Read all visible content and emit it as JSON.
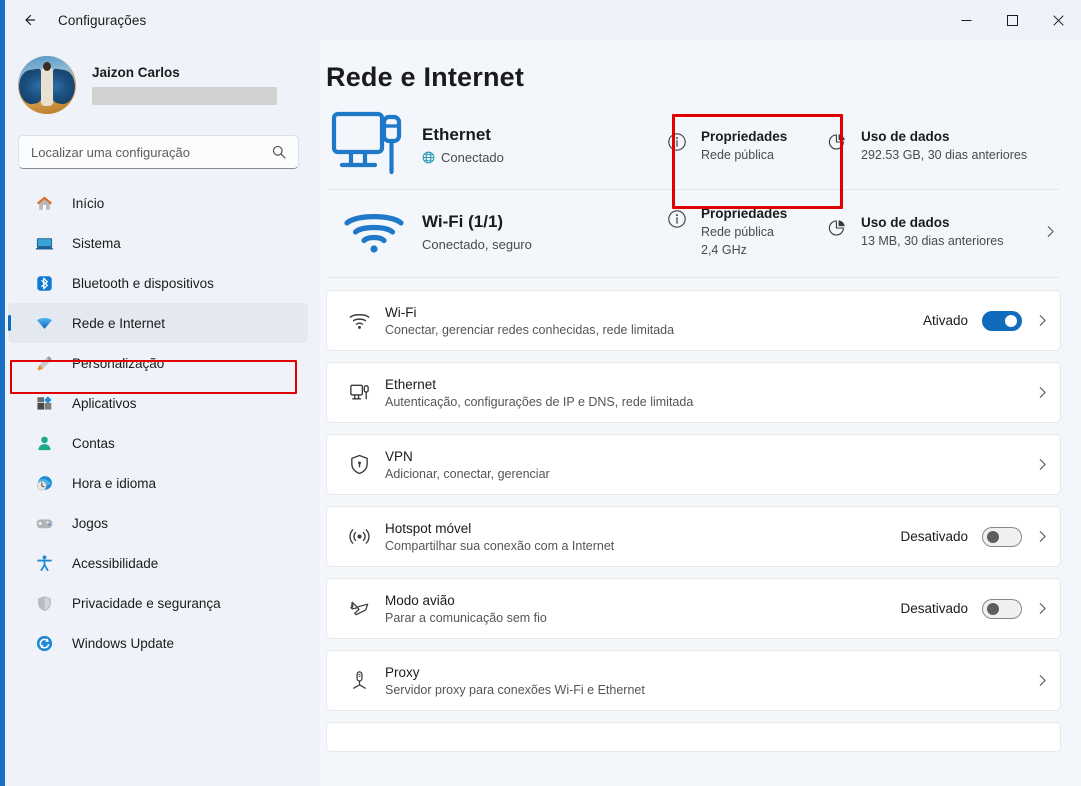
{
  "titlebar": {
    "back_icon": "arrow-left-icon",
    "title": "Configurações",
    "minimize_label": "—",
    "maximize_label": "□",
    "close_label": "✕"
  },
  "sidebar": {
    "profile": {
      "name": "Jaizon Carlos",
      "email_redacted": true,
      "avatar_icon": "user-avatar"
    },
    "search": {
      "placeholder": "Localizar uma configuração",
      "value": "",
      "icon": "search-icon"
    },
    "items": [
      {
        "label": "Início",
        "icon": "home-icon",
        "selected": false
      },
      {
        "label": "Sistema",
        "icon": "system-icon",
        "selected": false
      },
      {
        "label": "Bluetooth e dispositivos",
        "icon": "bluetooth-icon",
        "selected": false
      },
      {
        "label": "Rede e Internet",
        "icon": "network-icon",
        "selected": true
      },
      {
        "label": "Personalização",
        "icon": "paintbrush-icon",
        "selected": false
      },
      {
        "label": "Aplicativos",
        "icon": "apps-icon",
        "selected": false
      },
      {
        "label": "Contas",
        "icon": "account-icon",
        "selected": false
      },
      {
        "label": "Hora e idioma",
        "icon": "clock-globe-icon",
        "selected": false
      },
      {
        "label": "Jogos",
        "icon": "gamepad-icon",
        "selected": false
      },
      {
        "label": "Acessibilidade",
        "icon": "accessibility-icon",
        "selected": false
      },
      {
        "label": "Privacidade e segurança",
        "icon": "shield-icon",
        "selected": false
      },
      {
        "label": "Windows Update",
        "icon": "update-icon",
        "selected": false
      }
    ]
  },
  "main": {
    "page_title": "Rede e Internet",
    "ethernet_status": {
      "icon": "ethernet-monitor-icon",
      "name": "Ethernet",
      "status_icon": "globe-icon",
      "status": "Conectado",
      "properties": {
        "icon": "info-icon",
        "title": "Propriedades",
        "line1": "Rede pública",
        "line2": ""
      },
      "data_usage": {
        "icon": "pie-chart-icon",
        "title": "Uso de dados",
        "line1": "292.53 GB, 30 dias anteriores"
      }
    },
    "wifi_status": {
      "icon": "wifi-icon",
      "name": "Wi-Fi (1/1)",
      "status": "Conectado, seguro",
      "properties": {
        "icon": "info-icon",
        "title": "Propriedades",
        "line1": "Rede pública",
        "line2": "2,4 GHz",
        "highlighted": true
      },
      "data_usage": {
        "icon": "pie-chart-icon",
        "title": "Uso de dados",
        "line1": "13 MB, 30 dias anteriores"
      },
      "chevron": "chevron-right-icon"
    },
    "cards": [
      {
        "icon": "wifi-icon",
        "title": "Wi-Fi",
        "desc": "Conectar, gerenciar redes conhecidas, rede limitada",
        "toggle_label": "Ativado",
        "toggle_state": "on",
        "chevron": "chevron-right-icon"
      },
      {
        "icon": "ethernet-icon",
        "title": "Ethernet",
        "desc": "Autenticação, configurações de IP e DNS, rede limitada",
        "toggle_label": "",
        "toggle_state": "none",
        "chevron": "chevron-right-icon"
      },
      {
        "icon": "vpn-shield-icon",
        "title": "VPN",
        "desc": "Adicionar, conectar, gerenciar",
        "toggle_label": "",
        "toggle_state": "none",
        "chevron": "chevron-right-icon"
      },
      {
        "icon": "hotspot-icon",
        "title": "Hotspot móvel",
        "desc": "Compartilhar sua conexão com a Internet",
        "toggle_label": "Desativado",
        "toggle_state": "off",
        "chevron": "chevron-right-icon"
      },
      {
        "icon": "airplane-icon",
        "title": "Modo avião",
        "desc": "Parar a comunicação sem fio",
        "toggle_label": "Desativado",
        "toggle_state": "off",
        "chevron": "chevron-right-icon"
      },
      {
        "icon": "proxy-icon",
        "title": "Proxy",
        "desc": "Servidor proxy para conexões Wi-Fi e Ethernet",
        "toggle_label": "",
        "toggle_state": "none",
        "chevron": "chevron-right-icon"
      }
    ]
  },
  "colors": {
    "accent": "#0f6cbd",
    "annotation": "#e00000",
    "page_bg": "#f3f6fb",
    "sidebar_bg": "#eff3f9",
    "card_bg": "#ffffff"
  }
}
